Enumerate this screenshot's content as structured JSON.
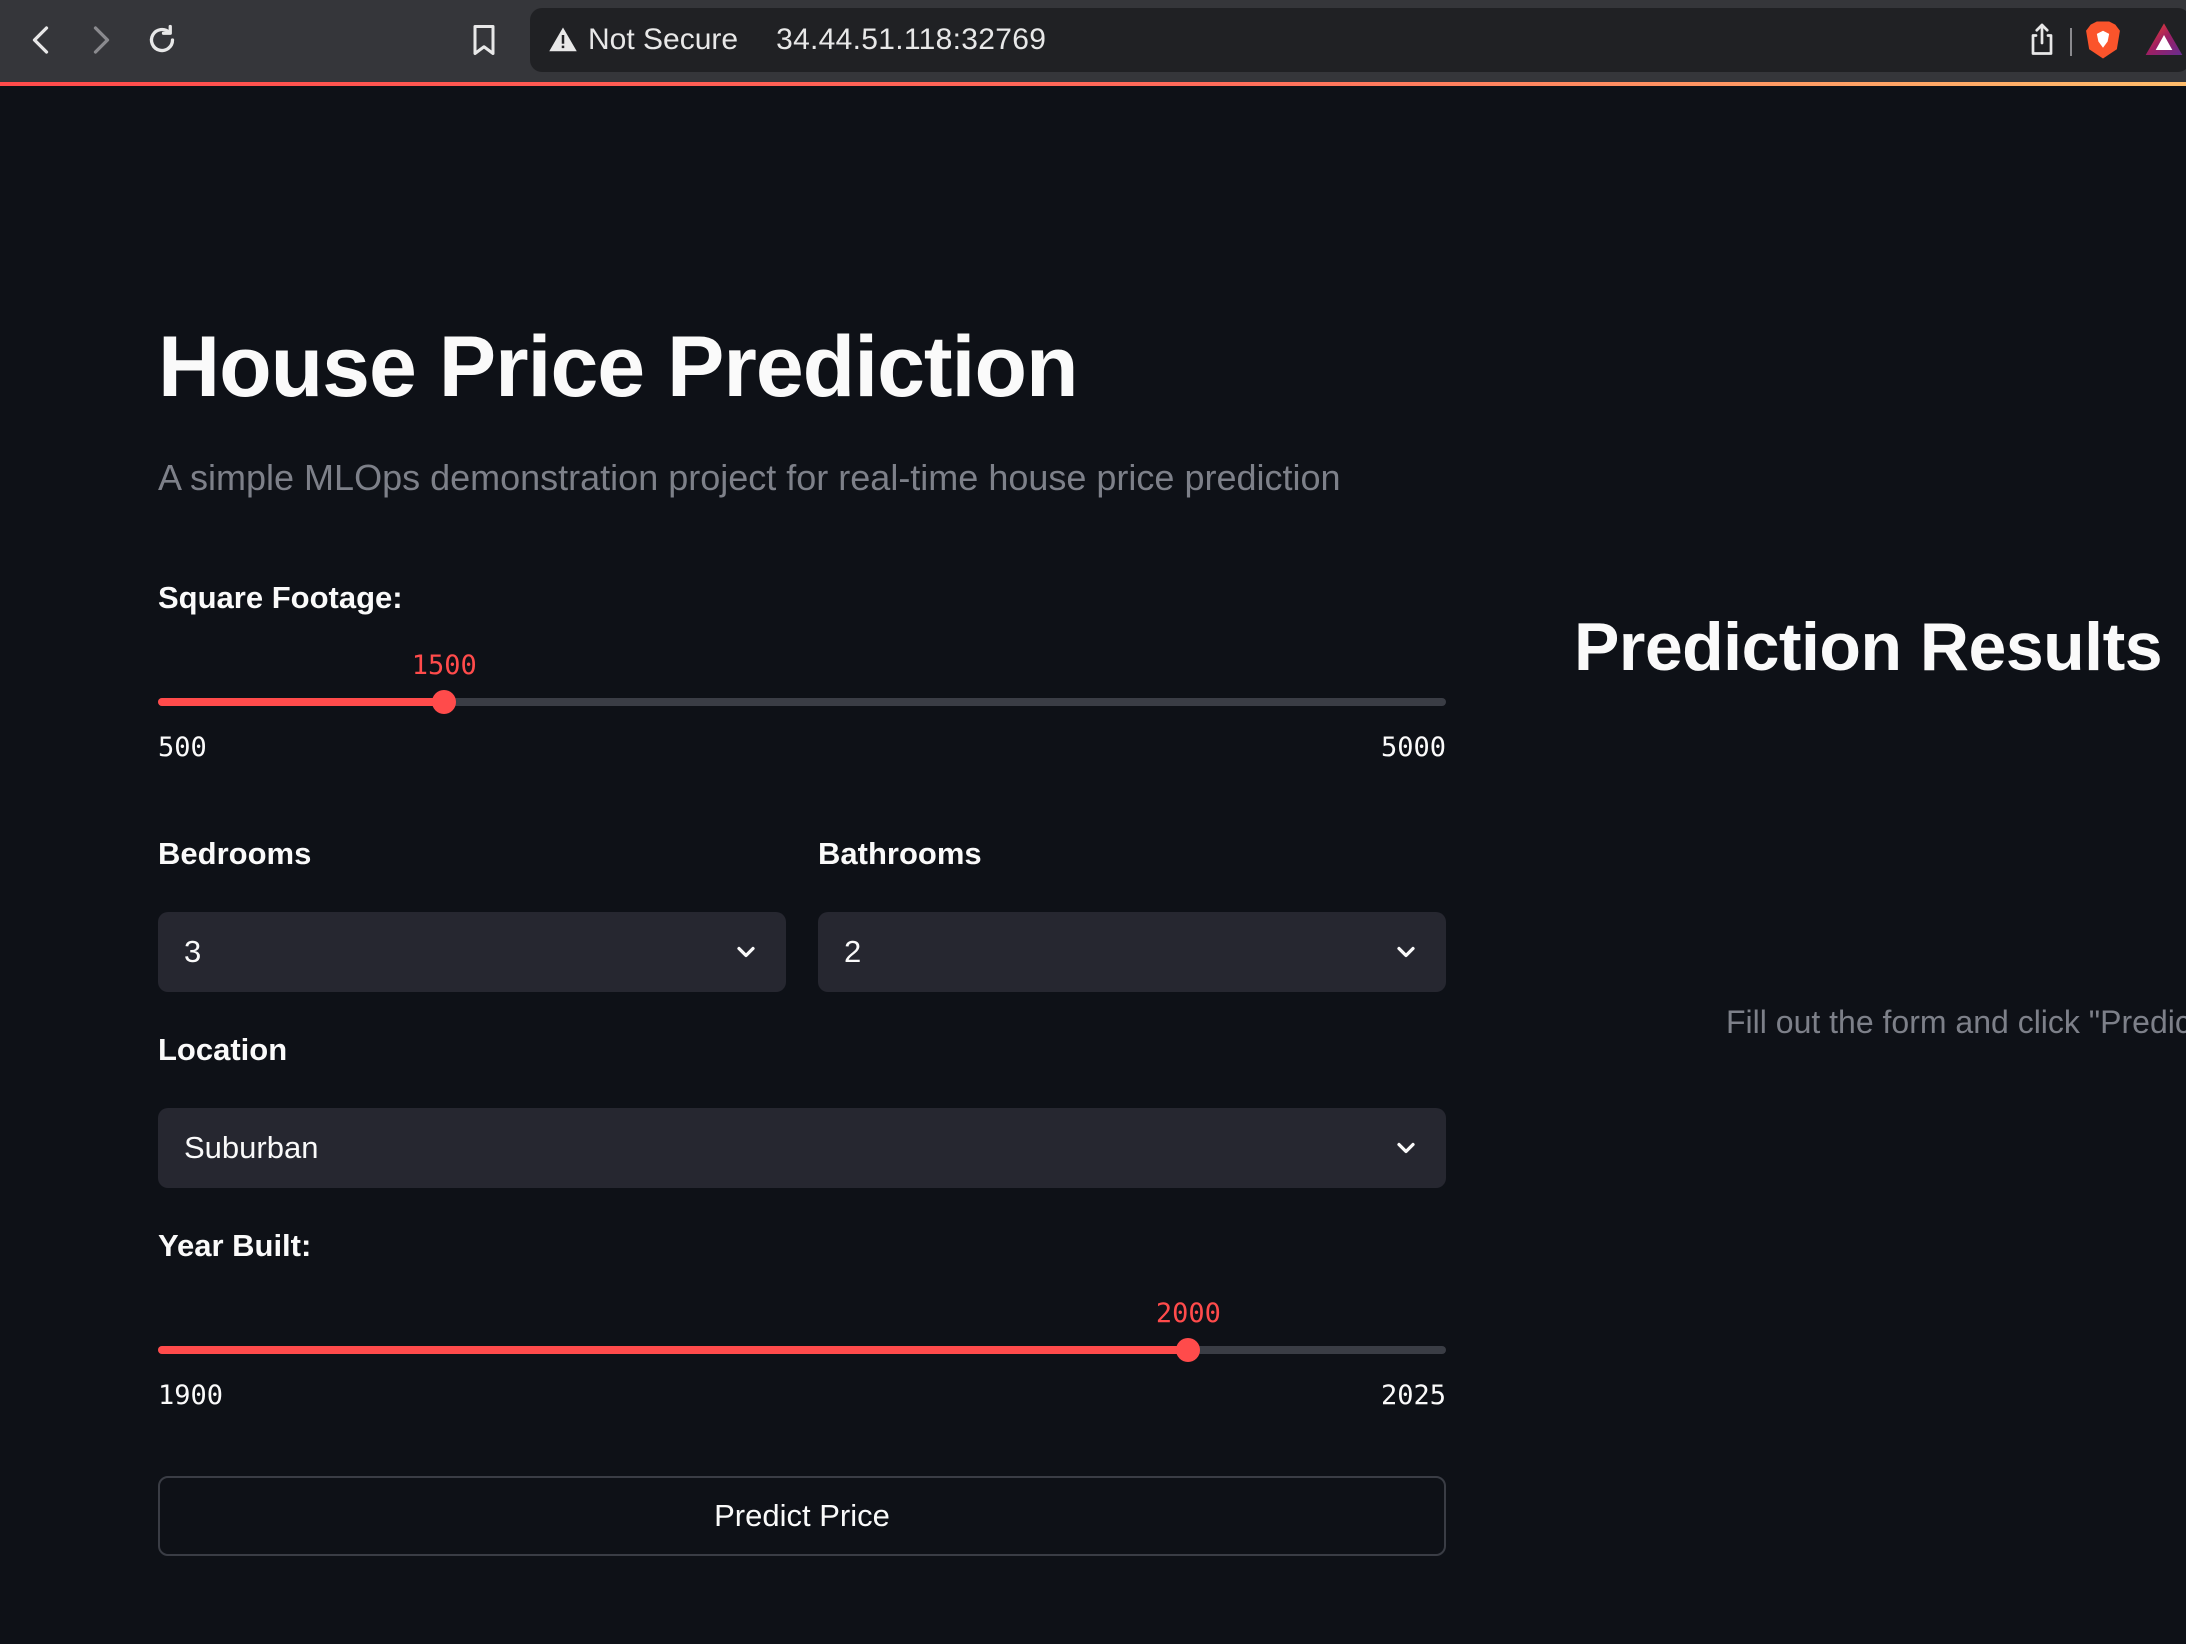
{
  "browser": {
    "security_label": "Not Secure",
    "address": "34.44.51.118:32769"
  },
  "app": {
    "title": "House Price Prediction",
    "subtitle": "A simple MLOps demonstration project for real-time house price prediction"
  },
  "form": {
    "square_footage": {
      "label": "Square Footage:",
      "value": 1500,
      "value_text": "1500",
      "min": 500,
      "max": 5000,
      "min_text": "500",
      "max_text": "5000"
    },
    "bedrooms": {
      "label": "Bedrooms",
      "value": "3"
    },
    "bathrooms": {
      "label": "Bathrooms",
      "value": "2"
    },
    "location": {
      "label": "Location",
      "value": "Suburban"
    },
    "year_built": {
      "label": "Year Built:",
      "value": 2000,
      "value_text": "2000",
      "min": 1900,
      "max": 2025,
      "min_text": "1900",
      "max_text": "2025"
    },
    "submit_label": "Predict Price"
  },
  "results": {
    "title": "Prediction Results",
    "hint": "Fill out the form and click \"Predict"
  },
  "colors": {
    "background": "#0e1117",
    "accent": "#ff4b4b",
    "input_bg": "#262730",
    "muted_text": "#7d8089"
  },
  "icons": {
    "back": "chevron-left-icon",
    "forward": "chevron-right-icon",
    "reload": "reload-icon",
    "bookmark": "bookmark-icon",
    "warning": "warning-triangle-icon",
    "share": "share-icon",
    "brave": "brave-lion-icon",
    "rewards": "brave-rewards-icon",
    "dropdown": "chevron-down-icon"
  }
}
